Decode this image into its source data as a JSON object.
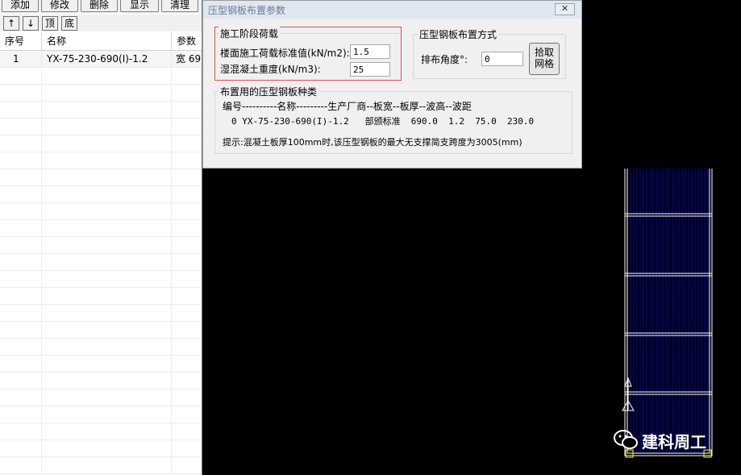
{
  "toolbar": {
    "add": "添加",
    "modify": "修改",
    "delete": "删除",
    "show": "显示",
    "clear": "清理",
    "up": "↑",
    "down": "↓",
    "top": "顶",
    "bottom": "底"
  },
  "grid": {
    "headers": [
      "序号",
      "名称",
      "参数"
    ],
    "rows": [
      {
        "index": "1",
        "name": "YX-75-230-690(I)-1.2",
        "param": "宽 69"
      }
    ]
  },
  "dialog": {
    "title": "压型钢板布置参数",
    "close": "✕",
    "loads_group": {
      "title": "施工阶段荷载",
      "floor_label": "楼面施工荷载标准值(kN/m2):",
      "floor_value": "1.5",
      "concrete_label": "湿混凝土重度(kN/m3):",
      "concrete_value": "25"
    },
    "layout_group": {
      "title": "压型钢板布置方式",
      "angle_label": "排布角度°:",
      "angle_value": "0",
      "pick_button_line1": "拾取",
      "pick_button_line2": "网格"
    },
    "types_group": {
      "title": "布置用的压型钢板种类",
      "header": "编号----------名称---------生产厂商--板宽--板厚--波高--波距",
      "row": "0 YX-75-230-690(I)-1.2   部颁标准  690.0  1.2  75.0  230.0",
      "hint": "提示:混凝土板厚100mm时,该压型钢板的最大无支撑简支跨度为3005(mm)"
    }
  },
  "watermark": {
    "text": "建科周工"
  },
  "colors": {
    "cad_background": "#000000",
    "deck_lines": "#0000cc",
    "outline": "#ffffff",
    "grips": "#ffff00"
  }
}
